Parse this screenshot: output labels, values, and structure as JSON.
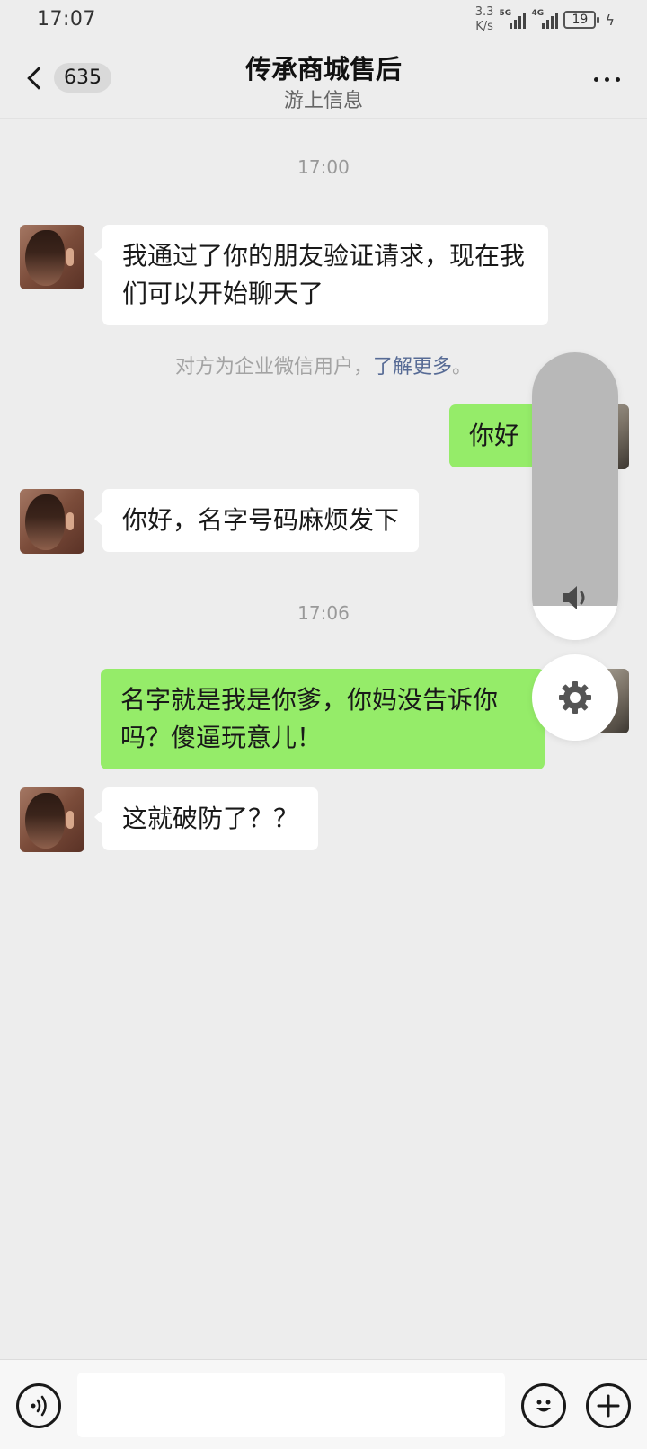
{
  "status_bar": {
    "time": "17:07",
    "net_speed_value": "3.3",
    "net_speed_unit": "K/s",
    "sim1_tag": "5G",
    "sim2_tag": "4G",
    "battery": "19"
  },
  "header": {
    "back_icon": "chevron-left-icon",
    "unread_count": "635",
    "title": "传承商城售后",
    "subtitle": "游上信息",
    "more_icon": "more-horizontal-icon"
  },
  "chat": {
    "time_1": "17:00",
    "msg_1": "我通过了你的朋友验证请求，现在我们可以开始聊天了",
    "system_text": "对方为企业微信用户，",
    "system_link": "了解更多",
    "system_end": "。",
    "msg_2": "你好",
    "msg_3": "你好，名字号码麻烦发下",
    "time_2": "17:06",
    "msg_4": "名字就是我是你爹，你妈没告诉你吗？傻逼玩意儿！",
    "msg_5": "这就破防了？？"
  },
  "volume_overlay": {
    "level": 0.88,
    "volume_icon": "speaker-icon",
    "settings_icon": "gear-icon"
  },
  "input_bar": {
    "voice_icon": "voice-icon",
    "input_value": "",
    "emoji_icon": "emoji-icon",
    "plus_icon": "plus-icon"
  },
  "colors": {
    "background": "#ededed",
    "outgoing_bubble": "#95ec69",
    "incoming_bubble": "#ffffff",
    "link": "#576b95"
  }
}
